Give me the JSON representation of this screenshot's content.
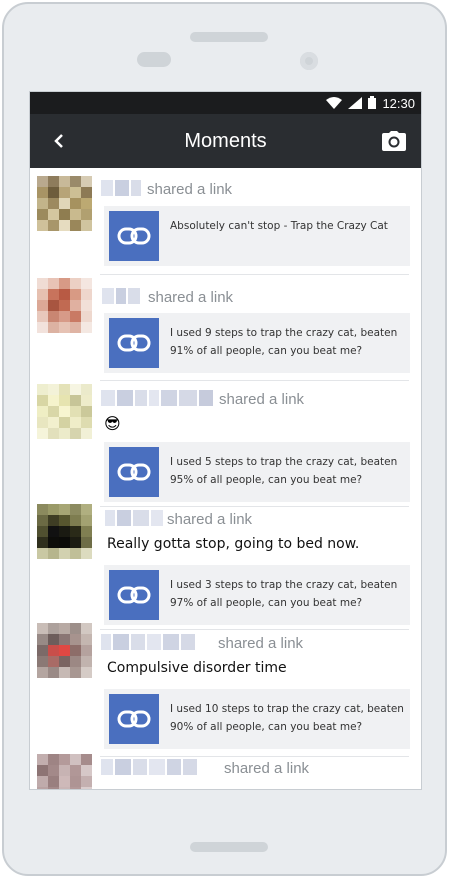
{
  "status_bar": {
    "time": "12:30"
  },
  "app_bar": {
    "title": "Moments"
  },
  "shared_label": "shared a link",
  "posts": [
    {
      "text": "",
      "emoji": "",
      "link": "Absolutely can't stop - Trap the Crazy Cat"
    },
    {
      "text": "",
      "emoji": "",
      "link": "I used 9 steps to trap the crazy cat, beaten 91% of all people, can you beat me?"
    },
    {
      "text": "",
      "emoji": "😎",
      "link": "I used 5 steps to trap the crazy cat, beaten 95% of all people, can you beat me?"
    },
    {
      "text": "Really gotta stop, going to bed now.",
      "emoji": "",
      "link": "I used 3 steps to trap the crazy cat, beaten 97% of all people, can you beat me?"
    },
    {
      "text": "Compulsive disorder time",
      "emoji": "",
      "link": "I used 10 steps to trap the crazy cat, beaten 90% of all people, can you beat me?"
    },
    {
      "text": "",
      "emoji": "",
      "link": ""
    }
  ],
  "colors": {
    "app_bar": "#2a2d31",
    "status_bar": "#1b1c1e",
    "link_icon_bg": "#4a6fbf",
    "link_card_bg": "#f0f1f3"
  },
  "icons": {
    "back": "chevron-left-icon",
    "camera": "camera-icon",
    "link": "chain-link-icon",
    "wifi": "wifi-icon",
    "signal": "signal-icon",
    "battery": "battery-icon"
  }
}
